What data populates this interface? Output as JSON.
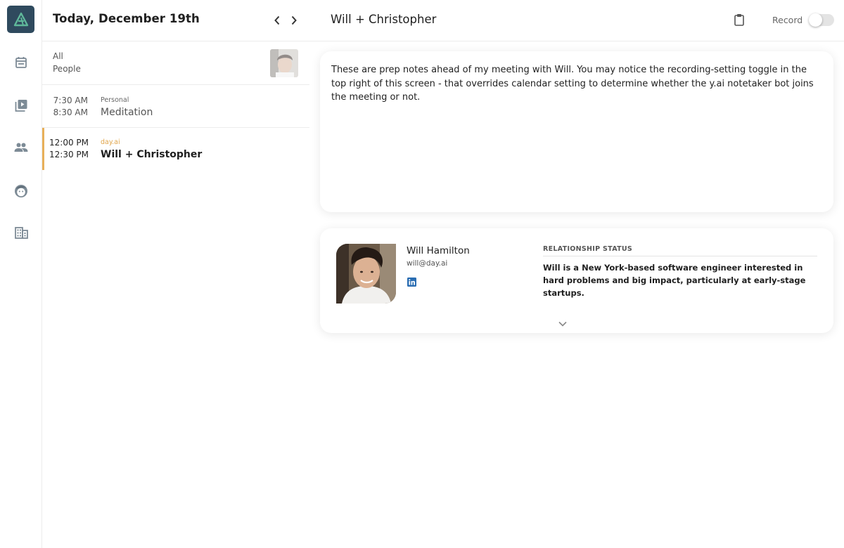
{
  "calendar": {
    "title": "Today, December 19th",
    "filter": {
      "line1": "All",
      "line2": "People"
    },
    "events": [
      {
        "start": "7:30 AM",
        "end": "8:30 AM",
        "category": "Personal",
        "name": "Meditation"
      },
      {
        "start": "12:00 PM",
        "end": "12:30 PM",
        "category": "day.ai",
        "name": "Will + Christopher"
      }
    ]
  },
  "meeting": {
    "title": "Will + Christopher",
    "record_label": "Record",
    "notes": "These are prep notes ahead of my meeting with Will. You may notice the recording-setting toggle in the top right of this screen - that overrides calendar setting to determine whether the y.ai notetaker bot joins the meeting or not."
  },
  "person": {
    "name": "Will Hamilton",
    "email": "will@day.ai",
    "relationship_heading": "RELATIONSHIP STATUS",
    "relationship_text": "Will is a New York-based software engineer interested in hard problems and big impact, particularly at early-stage startups."
  },
  "colors": {
    "logo_bg": "#2f4a5e",
    "logo_mark": "#5fb89a",
    "active_event_accent": "#e8b05a",
    "category_accent": "#e0a54a",
    "linkedin": "#2a6db2",
    "icon_gray": "#7d8b96"
  },
  "icons": {
    "rail": [
      "calendar-icon",
      "video-library-icon",
      "people-icon",
      "face-icon",
      "building-icon"
    ]
  }
}
